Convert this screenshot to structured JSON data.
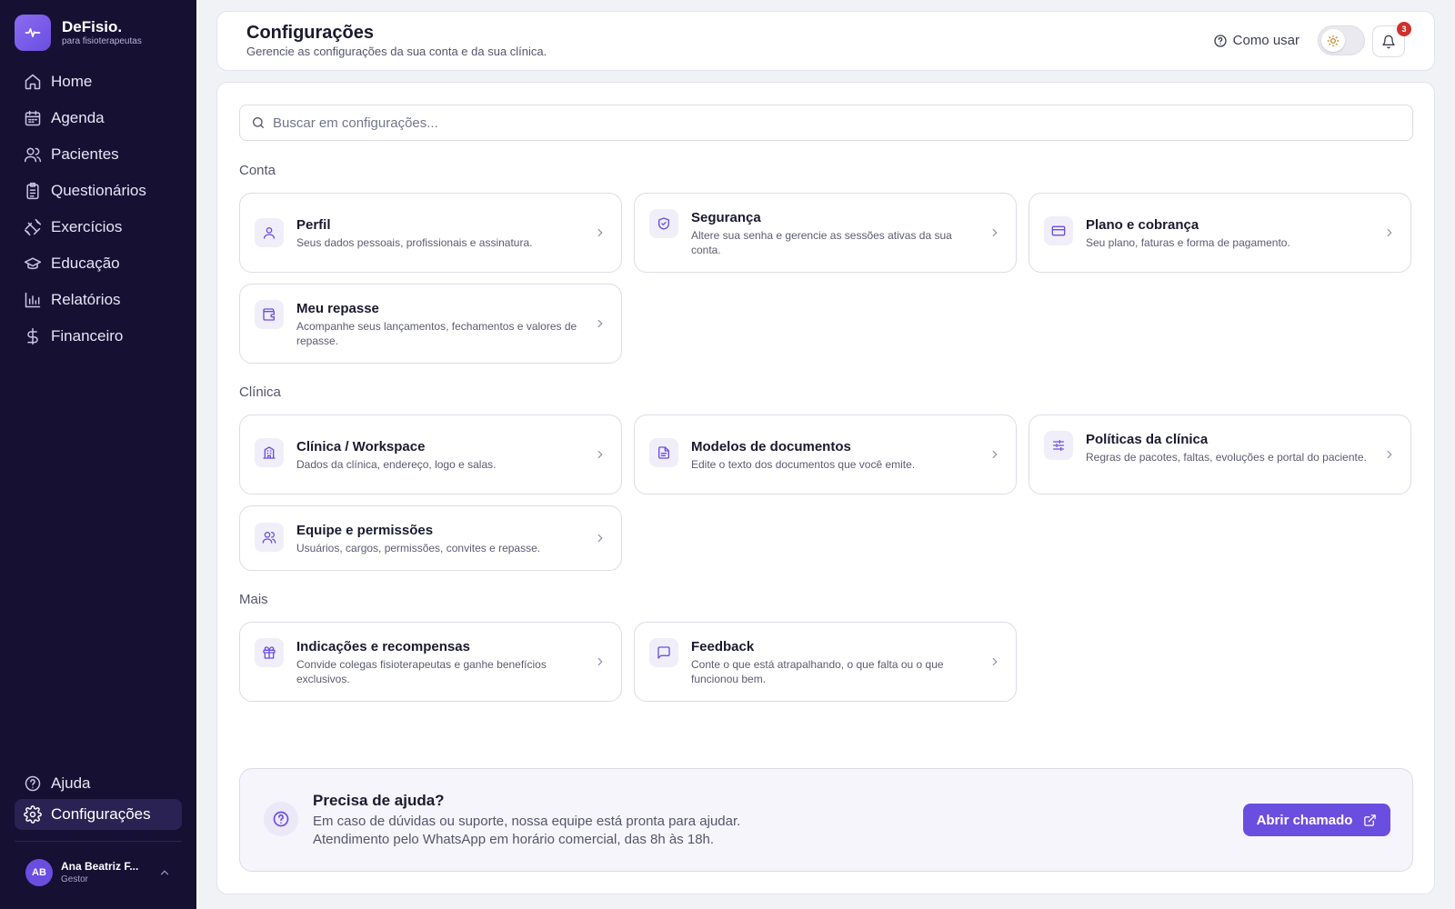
{
  "brand": {
    "name": "DeFisio.",
    "subtitle": "para fisioterapeutas"
  },
  "nav": {
    "items": [
      {
        "label": "Home",
        "icon": "home-icon"
      },
      {
        "label": "Agenda",
        "icon": "calendar-icon"
      },
      {
        "label": "Pacientes",
        "icon": "users-icon"
      },
      {
        "label": "Questionários",
        "icon": "clipboard-icon"
      },
      {
        "label": "Exercícios",
        "icon": "dumbbell-icon"
      },
      {
        "label": "Educação",
        "icon": "graduation-cap-icon"
      },
      {
        "label": "Relatórios",
        "icon": "bar-chart-icon"
      },
      {
        "label": "Financeiro",
        "icon": "dollar-icon"
      }
    ],
    "bottom": [
      {
        "label": "Ajuda",
        "icon": "help-circle-icon"
      },
      {
        "label": "Configurações",
        "icon": "gear-icon",
        "active": true
      }
    ]
  },
  "user": {
    "initials": "AB",
    "name": "Ana Beatriz F...",
    "role": "Gestor"
  },
  "header": {
    "title": "Configurações",
    "subtitle": "Gerencie as configurações da sua conta e da sua clínica.",
    "how_to": "Como usar",
    "notifications": "3"
  },
  "search": {
    "placeholder": "Buscar em configurações..."
  },
  "sections": [
    {
      "label": "Conta",
      "cards": [
        {
          "title": "Perfil",
          "desc": "Seus dados pessoais, profissionais e assinatura.",
          "icon": "user-icon"
        },
        {
          "title": "Segurança",
          "desc": "Altere sua senha e gerencie as sessões ativas da sua conta.",
          "icon": "shield-icon"
        },
        {
          "title": "Plano e cobrança",
          "desc": "Seu plano, faturas e forma de pagamento.",
          "icon": "credit-card-icon"
        },
        {
          "title": "Meu repasse",
          "desc": "Acompanhe seus lançamentos, fechamentos e valores de repasse.",
          "icon": "wallet-icon"
        }
      ]
    },
    {
      "label": "Clínica",
      "cards": [
        {
          "title": "Clínica / Workspace",
          "desc": "Dados da clínica, endereço, logo e salas.",
          "icon": "building-icon"
        },
        {
          "title": "Modelos de documentos",
          "desc": "Edite o texto dos documentos que você emite.",
          "icon": "document-icon"
        },
        {
          "title": "Políticas da clínica",
          "desc": "Regras de pacotes, faltas, evoluções e portal do paciente.",
          "icon": "sliders-icon"
        },
        {
          "title": "Equipe e permissões",
          "desc": "Usuários, cargos, permissões, convites e repasse.",
          "icon": "team-icon"
        }
      ]
    },
    {
      "label": "Mais",
      "cards": [
        {
          "title": "Indicações e recompensas",
          "desc": "Convide colegas fisioterapeutas e ganhe benefícios exclusivos.",
          "icon": "gift-icon"
        },
        {
          "title": "Feedback",
          "desc": "Conte o que está atrapalhando, o que falta ou o que funcionou bem.",
          "icon": "message-icon"
        }
      ]
    }
  ],
  "help": {
    "title": "Precisa de ajuda?",
    "line1": "Em caso de dúvidas ou suporte, nossa equipe está pronta para ajudar.",
    "line2": "Atendimento pelo WhatsApp em horário comercial, das 8h às 18h.",
    "button": "Abrir chamado"
  },
  "colors": {
    "sidebar": "#161033",
    "accent": "#6a4ee0",
    "badge": "#d0312d"
  }
}
